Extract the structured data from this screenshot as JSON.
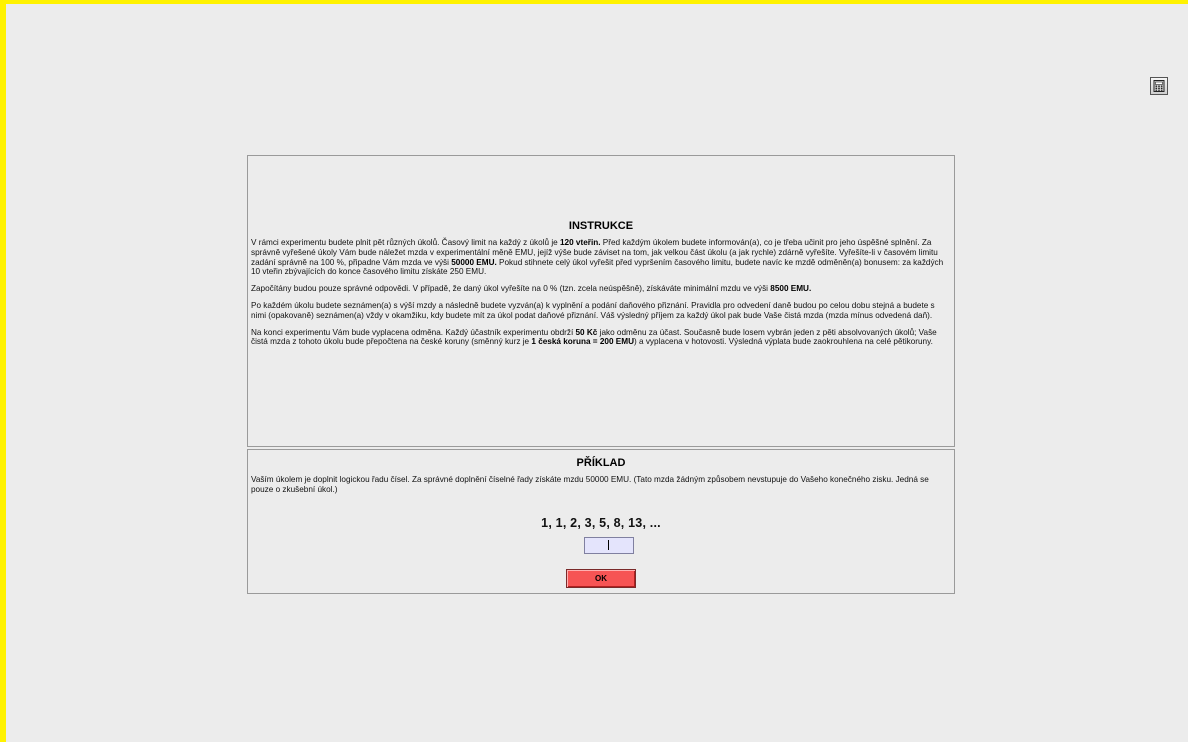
{
  "toolbar": {
    "calculator_icon": "calculator-icon"
  },
  "instructions": {
    "title": "INSTRUKCE",
    "p1": [
      {
        "t": "V rámci experimentu budete plnit pět různých úkolů. Časový limit na každý z úkolů je "
      },
      {
        "b": "120 vteřin."
      },
      {
        "t": " Před každým úkolem budete informován(a), co je třeba učinit pro jeho úspěšné splnění. Za správně vyřešené úkoly Vám bude náležet mzda v experimentální měně EMU, jejíž výše bude záviset na tom, jak velkou část úkolu (a jak rychle) zdárně vyřešíte. Vyřešíte-li v časovém limitu zadání správně na 100 %, připadne Vám mzda ve výši "
      },
      {
        "b": "50000 EMU."
      },
      {
        "t": " Pokud stihnete celý úkol vyřešit před vypršením časového limitu, budete navíc ke mzdě odměněn(a) bonusem: za každých 10 vteřin zbývajících do konce časového limitu získáte 250 EMU."
      }
    ],
    "p2": [
      {
        "t": "Započítány budou pouze správné odpovědi. V případě, že daný úkol vyřešíte na 0 % (tzn. zcela neúspěšně), získáváte minimální mzdu ve výši "
      },
      {
        "b": "8500 EMU."
      }
    ],
    "p3": [
      {
        "t": "Po každém úkolu budete seznámen(a) s výší mzdy a následně budete vyzván(a) k vyplnění a podání daňového přiznání. Pravidla pro odvedení daně budou po celou dobu stejná a budete s nimi (opakovaně) seznámen(a) vždy v okamžiku, kdy budete mít za úkol podat daňové přiznání. Váš výsledný příjem za každý úkol pak bude Vaše čistá mzda (mzda mínus odvedená daň)."
      }
    ],
    "p4": [
      {
        "t": "Na konci experimentu Vám bude vyplacena odměna. Každý účastník experimentu obdrží "
      },
      {
        "b": "50 Kč"
      },
      {
        "t": " jako odměnu za účast. Současně bude losem vybrán jeden z pěti absolvovaných úkolů;  Vaše čistá mzda z tohoto úkolu bude přepočtena na české koruny (směnný kurz je "
      },
      {
        "b": "1 česká koruna = 200 EMU"
      },
      {
        "t": ") a vyplacena v hotovosti. Výsledná výplata bude zaokrouhlena na celé pětikoruny."
      }
    ]
  },
  "example": {
    "title": "PŘÍKLAD",
    "text": "Vaším úkolem je doplnit logickou řadu čísel. Za správné doplnění číselné řady získáte mzdu 50000 EMU. (Tato mzda žádným způsobem nevstupuje do Vašeho konečného zisku. Jedná se pouze o zkušební úkol.)",
    "sequence": "1, 1, 2, 3, 5, 8, 13, ...",
    "answer_value": "",
    "ok_label": "OK"
  },
  "colors": {
    "frame_border": "#fff200",
    "background": "#ececec",
    "input_bg": "#e4e4fc",
    "ok_button": "#f65454"
  }
}
